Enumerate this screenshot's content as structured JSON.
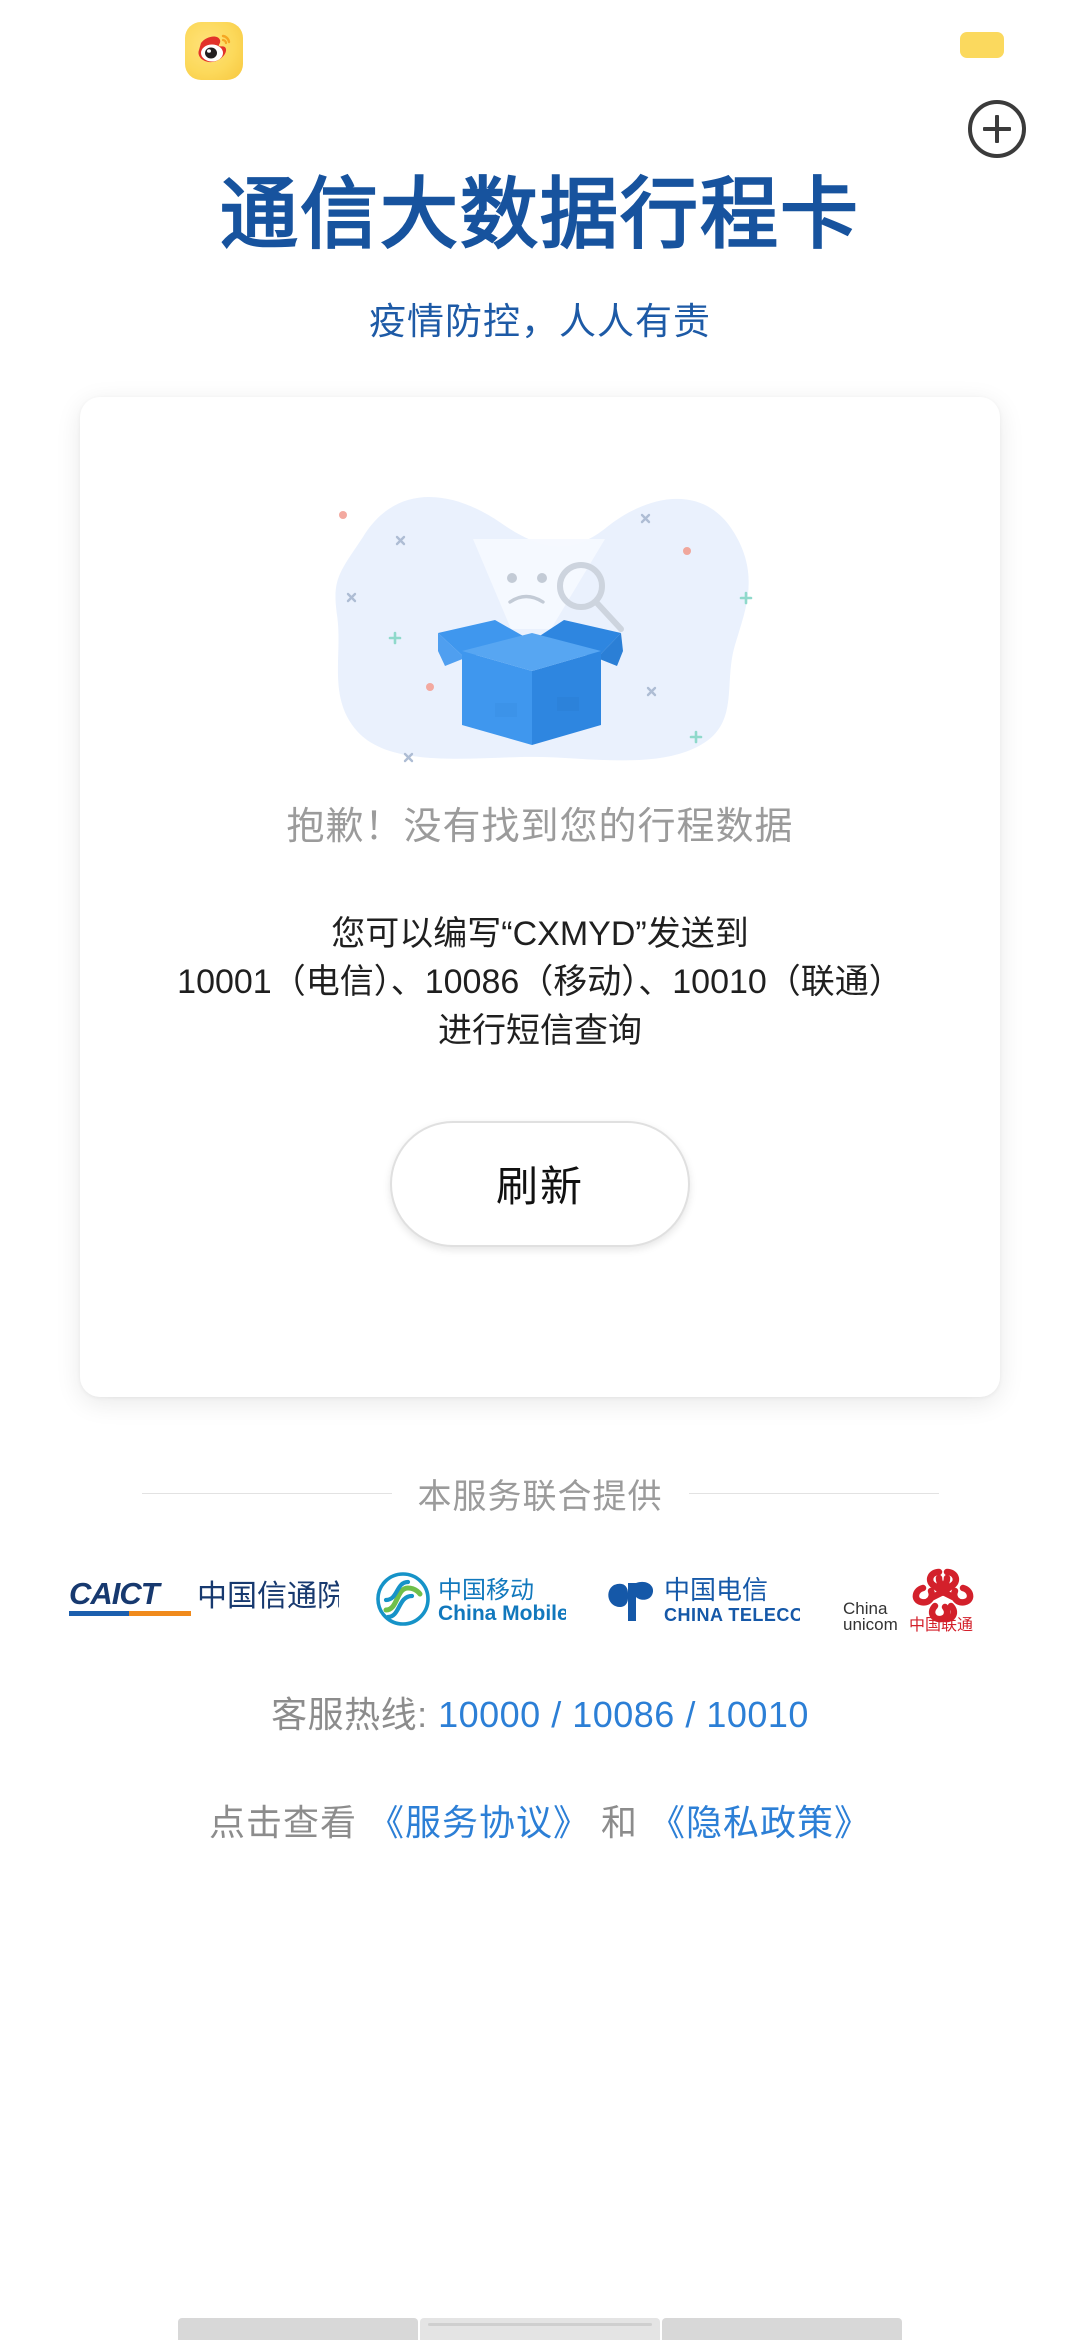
{
  "chrome": {
    "weibo_icon": "weibo-icon",
    "yellow_chip": "yellow-chip",
    "add_icon": "plus-circle-icon"
  },
  "header": {
    "title": "通信大数据行程卡",
    "subtitle": "疫情防控，人人有责",
    "title_color": "#17539e",
    "subtitle_color": "#1d5aa6"
  },
  "card": {
    "illustration": "empty-box-search-illustration",
    "empty_title": "抱歉！没有找到您的行程数据",
    "hint": "您可以编写“CXMYD”发送到\n10001（电信）、10086（移动）、10010（联通）\n进行短信查询",
    "refresh_label": "刷新"
  },
  "provided_by": {
    "label": "本服务联合提供",
    "logos": [
      {
        "name": "caict-logo",
        "abbr": "CAICT",
        "cn": "中国信通院",
        "en": ""
      },
      {
        "name": "china-mobile-logo",
        "abbr": "",
        "cn": "中国移动",
        "en": "China Mobile"
      },
      {
        "name": "china-telecom-logo",
        "abbr": "",
        "cn": "中国电信",
        "en": "CHINA TELECOM"
      },
      {
        "name": "china-unicom-logo",
        "abbr": "China unicom",
        "cn": "中国联通",
        "en": ""
      }
    ]
  },
  "footer": {
    "hotline_label": "客服热线:",
    "hotline_numbers": "10000 / 10086 / 10010",
    "agreement_prefix": "点击查看",
    "service_agreement": "《服务协议》",
    "agreement_conjunction": "和",
    "privacy_policy": "《隐私政策》",
    "link_color": "#2c7fd6"
  }
}
